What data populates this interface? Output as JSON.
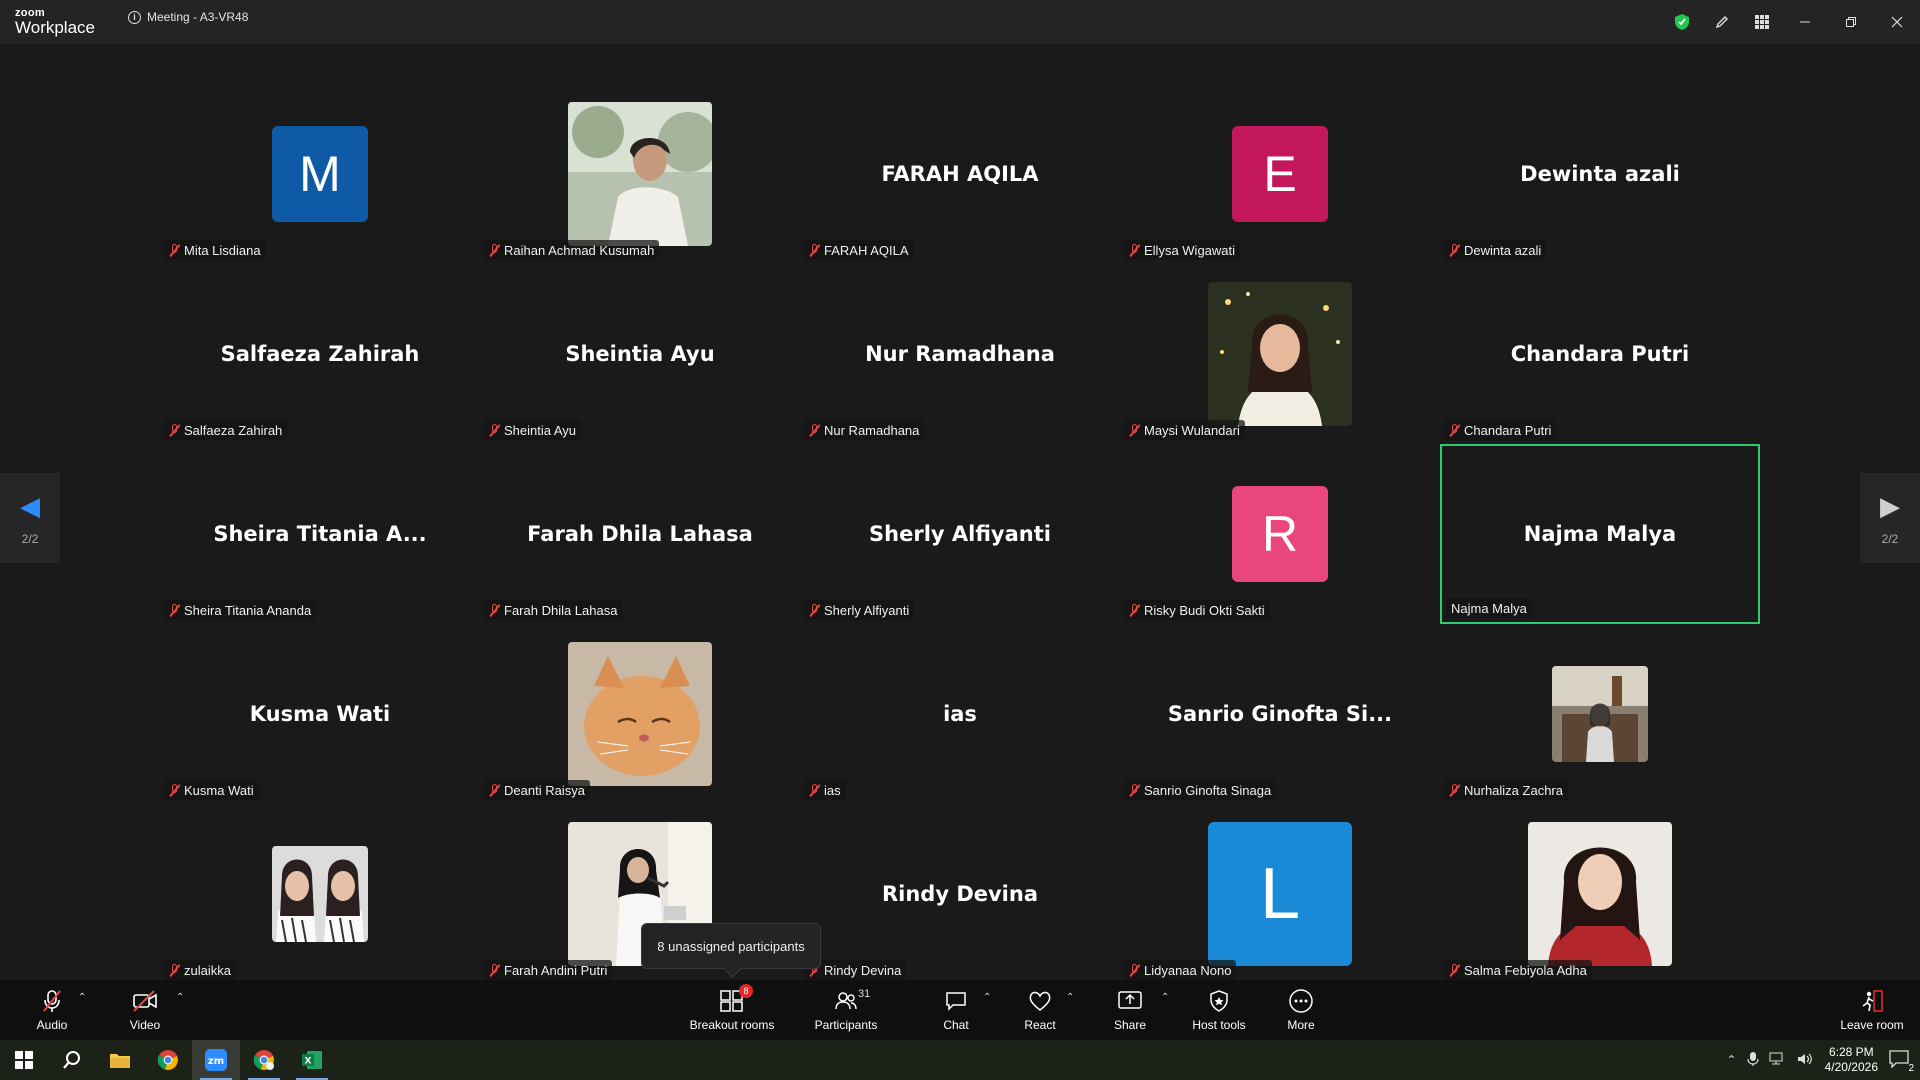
{
  "titlebar": {
    "brand_top": "zoom",
    "brand_main": "Workplace",
    "meeting_title": "Meeting - A3-VR48"
  },
  "pager": {
    "page": "2/2"
  },
  "participants": [
    {
      "label": "Mita Lisdiana",
      "kind": "initial",
      "initial": "M",
      "color": "#0e5aa7",
      "muted": true
    },
    {
      "label": "Raihan Achmad Kusumah",
      "kind": "photo",
      "photo": "man-profile",
      "muted": true
    },
    {
      "label": "FARAH AQILA",
      "kind": "name",
      "display": "FARAH AQILA",
      "muted": true
    },
    {
      "label": "Ellysa Wigawati",
      "kind": "initial",
      "initial": "E",
      "color": "#c2185b",
      "muted": true
    },
    {
      "label": "Dewinta azali",
      "kind": "name",
      "display": "Dewinta azali",
      "muted": true
    },
    {
      "label": "Salfaeza Zahirah",
      "kind": "name",
      "display": "Salfaeza Zahirah",
      "muted": true
    },
    {
      "label": "Sheintia Ayu",
      "kind": "name",
      "display": "Sheintia Ayu",
      "muted": true
    },
    {
      "label": "Nur Ramadhana",
      "kind": "name",
      "display": "Nur Ramadhana",
      "muted": true
    },
    {
      "label": "Maysi Wulandari",
      "kind": "photo",
      "photo": "woman-lights",
      "muted": true
    },
    {
      "label": "Chandara Putri",
      "kind": "name",
      "display": "Chandara Putri",
      "muted": true
    },
    {
      "label": "Sheira Titania Ananda",
      "kind": "name",
      "display": "Sheira Titania A...",
      "muted": true
    },
    {
      "label": "Farah Dhila Lahasa",
      "kind": "name",
      "display": "Farah Dhila Lahasa",
      "muted": true
    },
    {
      "label": "Sherly Alfiyanti",
      "kind": "name",
      "display": "Sherly Alfiyanti",
      "muted": true
    },
    {
      "label": "Risky Budi Okti Sakti",
      "kind": "initial",
      "initial": "R",
      "color": "#e8467c",
      "muted": true
    },
    {
      "label": "Najma Malya",
      "kind": "name",
      "display": "Najma Malya",
      "muted": false,
      "active": true
    },
    {
      "label": "Kusma Wati",
      "kind": "name",
      "display": "Kusma Wati",
      "muted": true
    },
    {
      "label": "Deanti Raisya",
      "kind": "photo",
      "photo": "cat",
      "muted": true
    },
    {
      "label": "ias",
      "kind": "name",
      "display": "ias",
      "muted": true
    },
    {
      "label": "Sanrio Ginofta Sinaga",
      "kind": "name",
      "display": "Sanrio Ginofta Si...",
      "muted": true
    },
    {
      "label": "Nurhaliza Zachra",
      "kind": "photo-sm",
      "photo": "woman-seated",
      "muted": true
    },
    {
      "label": "zulaikka",
      "kind": "photo-sm",
      "photo": "two-women",
      "muted": true
    },
    {
      "label": "Farah Andini Putri",
      "kind": "photo",
      "photo": "woman-hijab",
      "muted": true
    },
    {
      "label": "Rindy Devina",
      "kind": "name",
      "display": "Rindy Devina",
      "muted": true
    },
    {
      "label": "Lidyanaa Nono",
      "kind": "initial-big",
      "initial": "L",
      "color": "#1a8ad6",
      "muted": true
    },
    {
      "label": "Salma Febiyola Adha",
      "kind": "photo",
      "photo": "woman-red",
      "muted": true
    }
  ],
  "tooltip": "8 unassigned participants",
  "toolbar": {
    "audio": "Audio",
    "video": "Video",
    "breakout": "Breakout rooms",
    "breakout_badge": "8",
    "participants": "Participants",
    "participants_count": "31",
    "chat": "Chat",
    "react": "React",
    "share": "Share",
    "host_tools": "Host tools",
    "more": "More",
    "leave": "Leave room"
  },
  "taskbar": {
    "time": "6:28 PM",
    "date": "4/20/2026",
    "notifications": "2"
  },
  "colors": {
    "accent_blue": "#2d8cff",
    "active_speaker": "#2ecc71",
    "muted_red": "#e04848"
  }
}
